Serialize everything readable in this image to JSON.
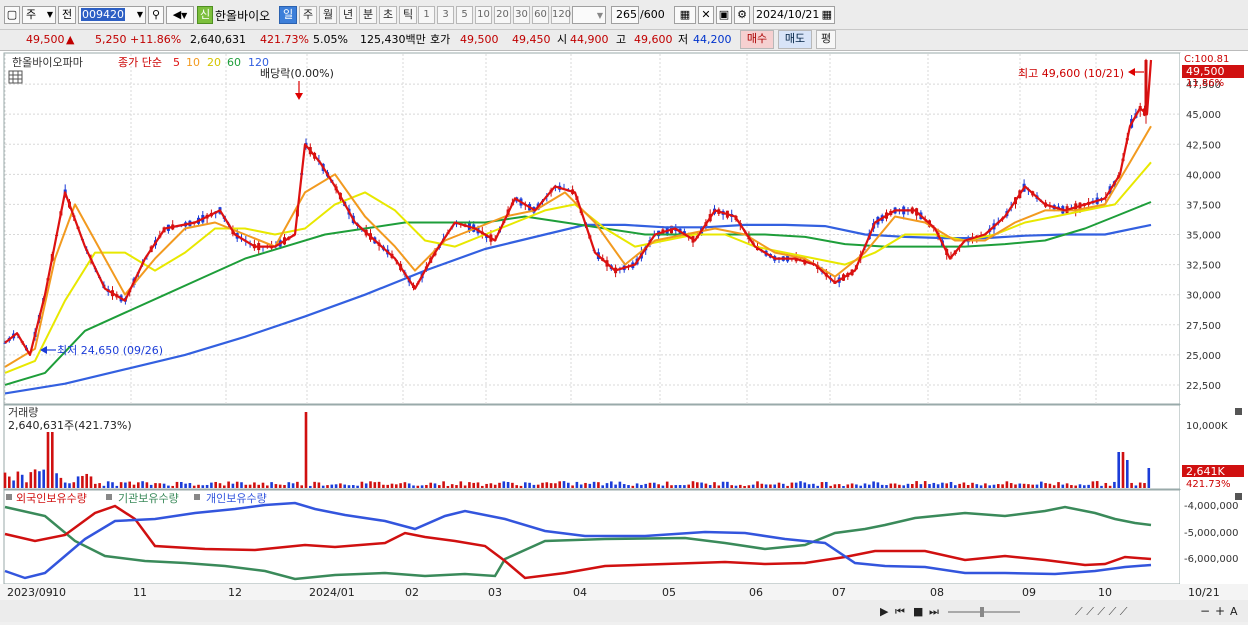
{
  "toolbar": {
    "type_select": "주",
    "full_label": "전",
    "code": "009420",
    "new_badge": "신",
    "stock_name": "한올바이오",
    "periods": [
      "일",
      "주",
      "월",
      "년",
      "분",
      "초",
      "틱"
    ],
    "active_period": "일",
    "intervals": [
      "1",
      "3",
      "5",
      "10",
      "20",
      "30",
      "60",
      "120"
    ],
    "count": "265",
    "count_total": "/600",
    "date": "2024/10/21"
  },
  "quote": {
    "price": "49,500",
    "up_mark": "▲",
    "change": "5,250",
    "change_pct": "+11.86%",
    "volume": "2,640,631",
    "volume_ratio": "421.73%",
    "turnover": "5.05%",
    "amount": "125,430백만",
    "bid_ask_label": "호가",
    "ask": "49,500",
    "bid": "49,450",
    "open_label": "시",
    "open": "44,900",
    "high_label": "고",
    "high": "49,600",
    "low_label": "저",
    "low": "44,200",
    "buy": "매수",
    "sell": "매도",
    "eval": "평"
  },
  "price_panel": {
    "title": "한올바이오파마",
    "ma_label": "종가 단순",
    "ma_periods": [
      "5",
      "10",
      "20",
      "60",
      "120"
    ],
    "ma_colors": [
      "#dd1111",
      "#f29a1f",
      "#e8e800",
      "#1e9e3a",
      "#3360e0"
    ],
    "dividend_label": "배당락(0.00%)",
    "high_annot": "최고 49,600 (10/21)",
    "low_annot": "최저 24,650 (09/26)",
    "axis_top_label": "C:100.81",
    "last_price_tag": "49,500",
    "last_pct_tag": "11.86%",
    "y_ticks": [
      "47,500",
      "45,000",
      "42,500",
      "40,000",
      "37,500",
      "35,000",
      "32,500",
      "30,000",
      "27,500",
      "25,000",
      "22,500"
    ]
  },
  "volume_panel": {
    "title": "거래량",
    "value": "2,640,631주(421.73%)",
    "y_tick": "10,000K",
    "last_tag": "2,641K",
    "last_pct": "421.73%"
  },
  "holding_panel": {
    "legend": [
      "외국인보유수량",
      "기관보유수량",
      "개인보유수량"
    ],
    "legend_colors": [
      "#d01010",
      "#3a8a5a",
      "#3355dd"
    ],
    "y_ticks": [
      "-4,000,000",
      "-5,000,000",
      "-6,000,000"
    ]
  },
  "x_axis": {
    "labels": [
      "2023/09",
      "10",
      "11",
      "12",
      "2024/01",
      "02",
      "03",
      "04",
      "05",
      "06",
      "07",
      "08",
      "09",
      "10"
    ],
    "end_label": "10/21"
  },
  "chart_data": {
    "type": "line",
    "title": "한올바이오파마",
    "x_range": [
      "2023-09-18",
      "2024-10-21"
    ],
    "ylim": [
      21000,
      50000
    ],
    "series": [
      {
        "name": "5",
        "values": [
          [
            0,
            26000
          ],
          [
            12,
            26800
          ],
          [
            25,
            25000
          ],
          [
            40,
            30000
          ],
          [
            60,
            38500
          ],
          [
            80,
            34000
          ],
          [
            100,
            30500
          ],
          [
            120,
            29500
          ],
          [
            140,
            33000
          ],
          [
            160,
            35500
          ],
          [
            190,
            36000
          ],
          [
            215,
            37000
          ],
          [
            230,
            35000
          ],
          [
            250,
            34000
          ],
          [
            270,
            34000
          ],
          [
            290,
            35000
          ],
          [
            300,
            42500
          ],
          [
            315,
            41000
          ],
          [
            330,
            39000
          ],
          [
            350,
            36000
          ],
          [
            370,
            34500
          ],
          [
            390,
            33000
          ],
          [
            410,
            30500
          ],
          [
            430,
            33500
          ],
          [
            450,
            36000
          ],
          [
            470,
            35500
          ],
          [
            490,
            34500
          ],
          [
            510,
            38000
          ],
          [
            530,
            37000
          ],
          [
            550,
            39000
          ],
          [
            570,
            38500
          ],
          [
            590,
            33500
          ],
          [
            610,
            32000
          ],
          [
            630,
            32500
          ],
          [
            650,
            35000
          ],
          [
            670,
            35500
          ],
          [
            690,
            34500
          ],
          [
            710,
            37000
          ],
          [
            730,
            36500
          ],
          [
            750,
            34000
          ],
          [
            770,
            33000
          ],
          [
            790,
            33000
          ],
          [
            810,
            32500
          ],
          [
            830,
            31000
          ],
          [
            850,
            32000
          ],
          [
            870,
            36000
          ],
          [
            890,
            37000
          ],
          [
            910,
            37000
          ],
          [
            930,
            35500
          ],
          [
            945,
            33000
          ],
          [
            960,
            34500
          ],
          [
            980,
            35000
          ],
          [
            1000,
            36500
          ],
          [
            1020,
            39000
          ],
          [
            1040,
            37500
          ],
          [
            1060,
            37000
          ],
          [
            1080,
            37500
          ],
          [
            1100,
            38000
          ],
          [
            1115,
            40000
          ],
          [
            1125,
            44000
          ],
          [
            1135,
            45500
          ],
          [
            1142,
            45000
          ],
          [
            1146,
            49500
          ]
        ]
      },
      {
        "name": "10",
        "values": [
          [
            0,
            24000
          ],
          [
            30,
            25500
          ],
          [
            50,
            33000
          ],
          [
            70,
            37500
          ],
          [
            90,
            34500
          ],
          [
            120,
            30000
          ],
          [
            150,
            33000
          ],
          [
            180,
            35500
          ],
          [
            210,
            36000
          ],
          [
            240,
            35000
          ],
          [
            270,
            34000
          ],
          [
            300,
            38500
          ],
          [
            330,
            40000
          ],
          [
            360,
            36500
          ],
          [
            390,
            34000
          ],
          [
            410,
            32000
          ],
          [
            440,
            34500
          ],
          [
            470,
            35500
          ],
          [
            500,
            36500
          ],
          [
            530,
            37000
          ],
          [
            560,
            38500
          ],
          [
            590,
            36000
          ],
          [
            620,
            32500
          ],
          [
            650,
            34500
          ],
          [
            680,
            35000
          ],
          [
            710,
            35500
          ],
          [
            740,
            35000
          ],
          [
            770,
            33500
          ],
          [
            800,
            33000
          ],
          [
            830,
            31500
          ],
          [
            860,
            33500
          ],
          [
            890,
            36500
          ],
          [
            920,
            36000
          ],
          [
            950,
            34500
          ],
          [
            980,
            34500
          ],
          [
            1010,
            36000
          ],
          [
            1040,
            37000
          ],
          [
            1070,
            37000
          ],
          [
            1100,
            37500
          ],
          [
            1125,
            41000
          ],
          [
            1146,
            44000
          ]
        ]
      },
      {
        "name": "20",
        "values": [
          [
            0,
            23500
          ],
          [
            30,
            24500
          ],
          [
            60,
            29500
          ],
          [
            90,
            33500
          ],
          [
            120,
            33500
          ],
          [
            150,
            32000
          ],
          [
            180,
            33500
          ],
          [
            210,
            35500
          ],
          [
            240,
            35500
          ],
          [
            270,
            35000
          ],
          [
            300,
            35500
          ],
          [
            330,
            37500
          ],
          [
            360,
            38500
          ],
          [
            390,
            37000
          ],
          [
            420,
            34500
          ],
          [
            450,
            34000
          ],
          [
            480,
            35000
          ],
          [
            510,
            36000
          ],
          [
            540,
            37000
          ],
          [
            570,
            37500
          ],
          [
            600,
            35500
          ],
          [
            630,
            34000
          ],
          [
            660,
            34500
          ],
          [
            690,
            35000
          ],
          [
            720,
            35000
          ],
          [
            750,
            34000
          ],
          [
            780,
            33500
          ],
          [
            810,
            33000
          ],
          [
            840,
            32500
          ],
          [
            870,
            33500
          ],
          [
            900,
            35000
          ],
          [
            930,
            35000
          ],
          [
            960,
            34500
          ],
          [
            990,
            35000
          ],
          [
            1020,
            36000
          ],
          [
            1050,
            36500
          ],
          [
            1080,
            37000
          ],
          [
            1110,
            37500
          ],
          [
            1146,
            41000
          ]
        ]
      },
      {
        "name": "60",
        "values": [
          [
            0,
            22500
          ],
          [
            40,
            23500
          ],
          [
            80,
            27000
          ],
          [
            120,
            28500
          ],
          [
            160,
            30000
          ],
          [
            200,
            31500
          ],
          [
            240,
            33000
          ],
          [
            280,
            34000
          ],
          [
            320,
            35000
          ],
          [
            360,
            35500
          ],
          [
            400,
            36000
          ],
          [
            440,
            36000
          ],
          [
            480,
            36000
          ],
          [
            520,
            36500
          ],
          [
            560,
            36000
          ],
          [
            600,
            35500
          ],
          [
            640,
            35000
          ],
          [
            680,
            35000
          ],
          [
            720,
            35000
          ],
          [
            760,
            35000
          ],
          [
            800,
            34800
          ],
          [
            840,
            34200
          ],
          [
            880,
            34000
          ],
          [
            920,
            34000
          ],
          [
            960,
            34000
          ],
          [
            1000,
            34200
          ],
          [
            1040,
            34500
          ],
          [
            1080,
            35500
          ],
          [
            1110,
            36500
          ],
          [
            1146,
            37700
          ]
        ]
      },
      {
        "name": "120",
        "values": [
          [
            0,
            21800
          ],
          [
            60,
            22600
          ],
          [
            120,
            23800
          ],
          [
            180,
            25000
          ],
          [
            240,
            26500
          ],
          [
            300,
            28200
          ],
          [
            360,
            30000
          ],
          [
            420,
            32000
          ],
          [
            480,
            33800
          ],
          [
            540,
            35000
          ],
          [
            580,
            35800
          ],
          [
            620,
            35800
          ],
          [
            660,
            35600
          ],
          [
            700,
            35600
          ],
          [
            740,
            35800
          ],
          [
            780,
            35800
          ],
          [
            820,
            35700
          ],
          [
            860,
            35000
          ],
          [
            900,
            34800
          ],
          [
            940,
            34700
          ],
          [
            980,
            34700
          ],
          [
            1020,
            34900
          ],
          [
            1060,
            35000
          ],
          [
            1100,
            35000
          ],
          [
            1146,
            35800
          ]
        ]
      }
    ]
  }
}
